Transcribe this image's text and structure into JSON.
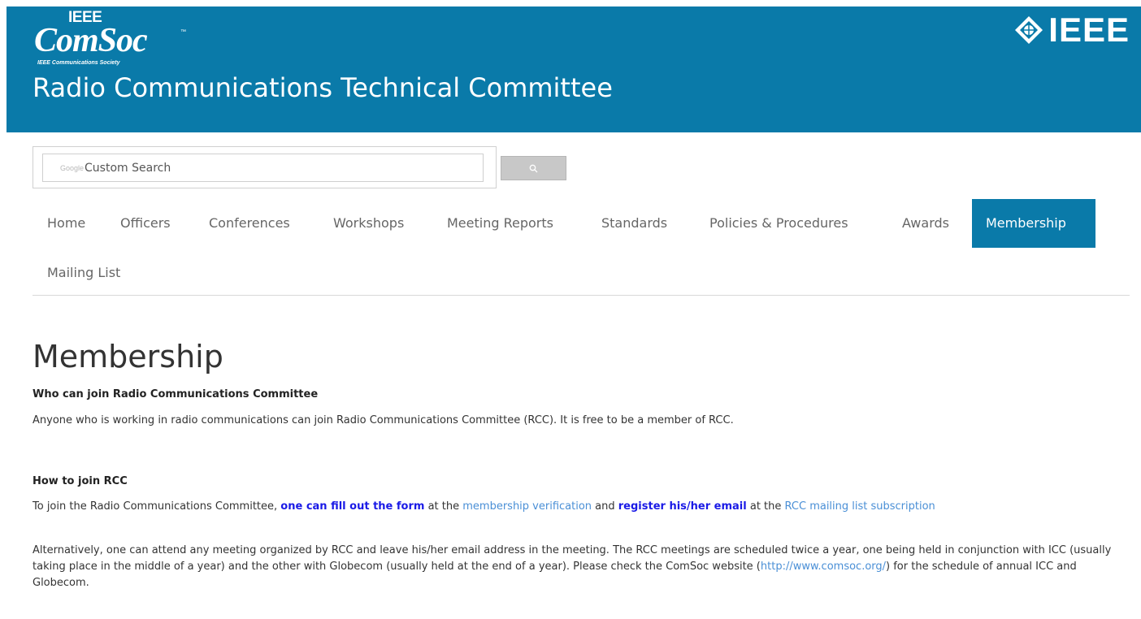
{
  "header": {
    "comsoc_logo": {
      "top_text": "IEEE",
      "word": "ComSoc",
      "tm": "™",
      "subtitle": "IEEE Communications Society"
    },
    "ieee_logo_text": "IEEE",
    "site_title": "Radio Communications Technical Committee",
    "background_color": "#0a7aa9"
  },
  "search": {
    "google_mark": "Google",
    "placeholder": "Custom Search",
    "button_icon": "search-icon"
  },
  "nav": {
    "items": [
      {
        "label": "Home"
      },
      {
        "label": "Officers"
      },
      {
        "label": "Conferences"
      },
      {
        "label": "Workshops"
      },
      {
        "label": "Meeting Reports"
      },
      {
        "label": "Standards"
      },
      {
        "label": "Policies & Procedures"
      },
      {
        "label": "Awards"
      },
      {
        "label": "Membership",
        "active": true
      },
      {
        "label": "Mailing List"
      }
    ],
    "active_color": "#0a7aa9"
  },
  "content": {
    "page_title": "Membership",
    "section1": {
      "heading": "Who can join Radio Communications Committee",
      "text": "Anyone who is working in radio communications can join Radio Communications Committee (RCC). It is free to be a member of RCC."
    },
    "section2": {
      "heading": "How to join RCC",
      "p1": {
        "t1": "To join the Radio Communications Committee, ",
        "link1": "one can fill out the form",
        "t2": " at the ",
        "link2": "membership verification",
        "t3": " and ",
        "link3": "register his/her email",
        "t4": " at the ",
        "link4": "RCC mailing list subscription"
      },
      "p2": {
        "t1": "Alternatively, one can attend any meeting organized by RCC and leave his/her email address in the meeting. The RCC meetings are scheduled twice a year, one being held in conjunction with ICC (usually taking place in the middle of a year) and the other with Globecom (usually held at the end of a year). Please check the ComSoc website (",
        "link": "http://www.comsoc.org/",
        "t2": ") for the schedule of annual ICC and Globecom."
      }
    }
  }
}
